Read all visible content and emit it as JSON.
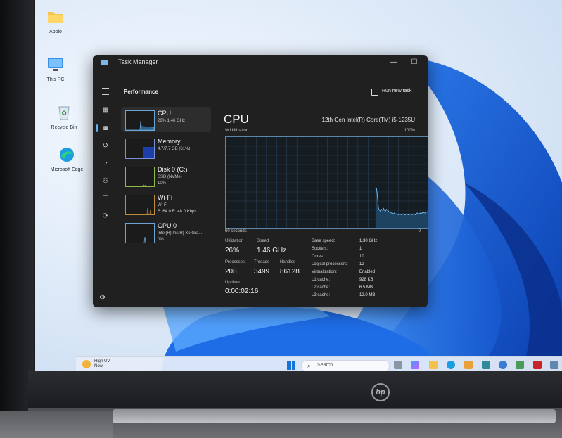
{
  "desktop": {
    "icons": [
      {
        "label": "Apolo",
        "icon": "folder-icon"
      },
      {
        "label": "This PC",
        "icon": "monitor-icon"
      },
      {
        "label": "Recycle Bin",
        "icon": "recycle-bin-icon"
      },
      {
        "label": "Microsoft Edge",
        "icon": "edge-icon"
      }
    ]
  },
  "task_manager": {
    "window_title": "Task Manager",
    "window_controls": {
      "minimize": "—",
      "maximize": "☐",
      "close": "✕"
    },
    "header": {
      "title": "Performance",
      "run_new_task": "Run new task",
      "more": "•••"
    },
    "nav_icons": [
      "processes-icon",
      "performance-icon",
      "app-history-icon",
      "startup-apps-icon",
      "users-icon",
      "details-icon",
      "services-icon"
    ],
    "settings_icon": "gear-icon",
    "resources": [
      {
        "name": "CPU",
        "sub1": "26%  1.46 GHz",
        "sub2": "",
        "selected": true
      },
      {
        "name": "Memory",
        "sub1": "4.7/7.7 GB (61%)",
        "sub2": "",
        "selected": false,
        "fill": 0.61
      },
      {
        "name": "Disk 0 (C:)",
        "sub1": "SSD (NVMe)",
        "sub2": "10%",
        "selected": false
      },
      {
        "name": "Wi-Fi",
        "sub1": "Wi-Fi",
        "sub2": "S: 64.0  R: 48.0 Kbps",
        "selected": false
      },
      {
        "name": "GPU 0",
        "sub1": "Intel(R) Iris(R) Xe Gra...",
        "sub2": "0%",
        "selected": false
      }
    ],
    "cpu": {
      "title": "CPU",
      "model": "12th Gen Intel(R) Core(TM) i5-1235U",
      "graph_label": "% Utilization",
      "graph_max": "100%",
      "axis_left": "60 seconds",
      "axis_right": "0",
      "utilization_series": [
        0,
        0,
        0,
        0,
        0,
        0,
        0,
        0,
        0,
        0,
        0,
        0,
        0,
        0,
        0,
        0,
        0,
        0,
        0,
        0,
        0,
        0,
        0,
        0,
        0,
        0,
        0,
        0,
        0,
        0,
        0,
        0,
        0,
        0,
        0,
        0,
        0,
        0,
        0,
        0,
        0,
        0,
        0,
        0,
        0,
        0,
        0,
        0,
        0,
        0,
        0,
        0,
        0,
        0,
        0,
        0,
        0,
        0,
        0,
        0,
        0,
        0,
        0,
        0,
        0,
        0,
        0,
        0,
        0,
        0,
        0,
        0,
        0,
        0,
        0,
        0,
        0,
        0,
        0,
        0,
        0,
        0,
        0,
        0,
        0,
        0,
        0,
        0,
        0,
        0,
        0,
        0,
        0,
        0,
        0,
        0,
        0,
        0,
        0,
        0,
        0,
        0,
        0,
        0,
        0,
        0,
        0,
        0,
        0,
        0,
        0,
        0,
        0,
        0,
        0,
        0,
        0,
        0,
        0,
        0,
        0,
        0,
        0,
        0,
        0,
        0,
        0,
        0,
        0,
        0,
        0,
        0,
        0,
        0,
        0,
        0,
        0,
        0,
        0,
        0,
        0,
        0,
        0,
        0,
        0,
        0,
        0,
        0,
        0,
        0,
        0,
        45,
        44,
        35,
        22,
        20,
        19,
        21,
        20,
        22,
        20,
        19,
        21,
        20,
        19,
        18,
        18,
        17,
        17,
        16,
        17,
        16,
        16,
        16,
        15,
        16,
        16,
        15,
        16,
        16,
        15,
        15,
        16,
        16,
        15,
        15,
        16,
        16,
        15,
        16,
        16,
        15,
        16,
        17,
        16,
        16,
        17,
        16,
        17,
        18,
        17,
        17,
        18,
        18,
        19,
        26
      ],
      "stats": {
        "utilization_label": "Utilization",
        "utilization": "26%",
        "speed_label": "Speed",
        "speed": "1.46 GHz",
        "processes_label": "Processes",
        "processes": "208",
        "threads_label": "Threads",
        "threads": "3499",
        "handles_label": "Handles",
        "handles": "86128",
        "uptime_label": "Up time",
        "uptime": "0:00:02:16"
      },
      "specs": [
        {
          "k": "Base speed:",
          "v": "1.30 GHz"
        },
        {
          "k": "Sockets:",
          "v": "1"
        },
        {
          "k": "Cores:",
          "v": "10"
        },
        {
          "k": "Logical processors:",
          "v": "12"
        },
        {
          "k": "Virtualization:",
          "v": "Enabled"
        },
        {
          "k": "L1 cache:",
          "v": "928 KB"
        },
        {
          "k": "L2 cache:",
          "v": "6.5 MB"
        },
        {
          "k": "L3 cache:",
          "v": "12.0 MB"
        }
      ]
    }
  },
  "taskbar": {
    "weather_line1": "High UV",
    "weather_line2": "Now",
    "search_placeholder": "Search",
    "search_icon": "search-icon",
    "pinned_icons": [
      "task-view-icon",
      "copilot-icon",
      "file-explorer-icon",
      "edge-icon",
      "store-icon",
      "mail-icon",
      "photos-icon",
      "chrome-icon",
      "mcafee-icon",
      "task-manager-icon"
    ]
  },
  "hardware": {
    "logo": "hp"
  }
}
